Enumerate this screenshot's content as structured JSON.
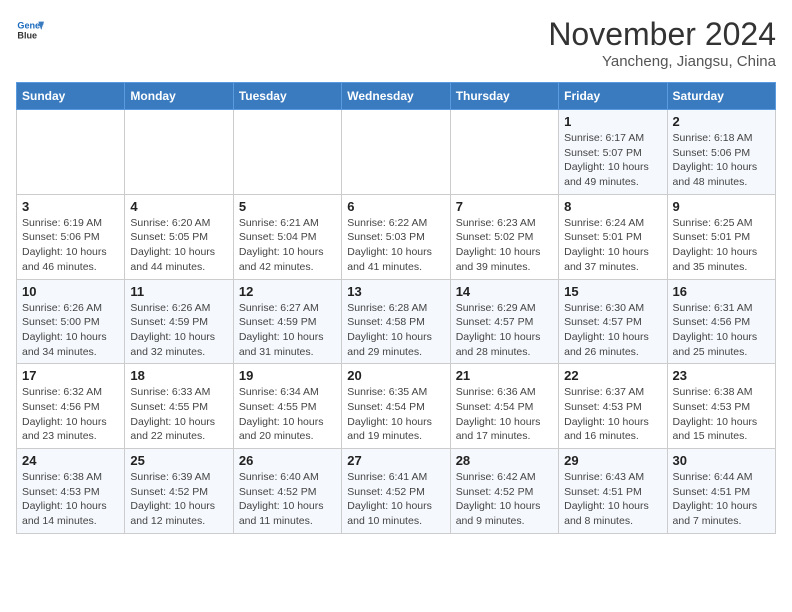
{
  "header": {
    "logo_line1": "General",
    "logo_line2": "Blue",
    "month_title": "November 2024",
    "location": "Yancheng, Jiangsu, China"
  },
  "weekdays": [
    "Sunday",
    "Monday",
    "Tuesday",
    "Wednesday",
    "Thursday",
    "Friday",
    "Saturday"
  ],
  "weeks": [
    [
      {
        "day": "",
        "info": ""
      },
      {
        "day": "",
        "info": ""
      },
      {
        "day": "",
        "info": ""
      },
      {
        "day": "",
        "info": ""
      },
      {
        "day": "",
        "info": ""
      },
      {
        "day": "1",
        "info": "Sunrise: 6:17 AM\nSunset: 5:07 PM\nDaylight: 10 hours and 49 minutes."
      },
      {
        "day": "2",
        "info": "Sunrise: 6:18 AM\nSunset: 5:06 PM\nDaylight: 10 hours and 48 minutes."
      }
    ],
    [
      {
        "day": "3",
        "info": "Sunrise: 6:19 AM\nSunset: 5:06 PM\nDaylight: 10 hours and 46 minutes."
      },
      {
        "day": "4",
        "info": "Sunrise: 6:20 AM\nSunset: 5:05 PM\nDaylight: 10 hours and 44 minutes."
      },
      {
        "day": "5",
        "info": "Sunrise: 6:21 AM\nSunset: 5:04 PM\nDaylight: 10 hours and 42 minutes."
      },
      {
        "day": "6",
        "info": "Sunrise: 6:22 AM\nSunset: 5:03 PM\nDaylight: 10 hours and 41 minutes."
      },
      {
        "day": "7",
        "info": "Sunrise: 6:23 AM\nSunset: 5:02 PM\nDaylight: 10 hours and 39 minutes."
      },
      {
        "day": "8",
        "info": "Sunrise: 6:24 AM\nSunset: 5:01 PM\nDaylight: 10 hours and 37 minutes."
      },
      {
        "day": "9",
        "info": "Sunrise: 6:25 AM\nSunset: 5:01 PM\nDaylight: 10 hours and 35 minutes."
      }
    ],
    [
      {
        "day": "10",
        "info": "Sunrise: 6:26 AM\nSunset: 5:00 PM\nDaylight: 10 hours and 34 minutes."
      },
      {
        "day": "11",
        "info": "Sunrise: 6:26 AM\nSunset: 4:59 PM\nDaylight: 10 hours and 32 minutes."
      },
      {
        "day": "12",
        "info": "Sunrise: 6:27 AM\nSunset: 4:59 PM\nDaylight: 10 hours and 31 minutes."
      },
      {
        "day": "13",
        "info": "Sunrise: 6:28 AM\nSunset: 4:58 PM\nDaylight: 10 hours and 29 minutes."
      },
      {
        "day": "14",
        "info": "Sunrise: 6:29 AM\nSunset: 4:57 PM\nDaylight: 10 hours and 28 minutes."
      },
      {
        "day": "15",
        "info": "Sunrise: 6:30 AM\nSunset: 4:57 PM\nDaylight: 10 hours and 26 minutes."
      },
      {
        "day": "16",
        "info": "Sunrise: 6:31 AM\nSunset: 4:56 PM\nDaylight: 10 hours and 25 minutes."
      }
    ],
    [
      {
        "day": "17",
        "info": "Sunrise: 6:32 AM\nSunset: 4:56 PM\nDaylight: 10 hours and 23 minutes."
      },
      {
        "day": "18",
        "info": "Sunrise: 6:33 AM\nSunset: 4:55 PM\nDaylight: 10 hours and 22 minutes."
      },
      {
        "day": "19",
        "info": "Sunrise: 6:34 AM\nSunset: 4:55 PM\nDaylight: 10 hours and 20 minutes."
      },
      {
        "day": "20",
        "info": "Sunrise: 6:35 AM\nSunset: 4:54 PM\nDaylight: 10 hours and 19 minutes."
      },
      {
        "day": "21",
        "info": "Sunrise: 6:36 AM\nSunset: 4:54 PM\nDaylight: 10 hours and 17 minutes."
      },
      {
        "day": "22",
        "info": "Sunrise: 6:37 AM\nSunset: 4:53 PM\nDaylight: 10 hours and 16 minutes."
      },
      {
        "day": "23",
        "info": "Sunrise: 6:38 AM\nSunset: 4:53 PM\nDaylight: 10 hours and 15 minutes."
      }
    ],
    [
      {
        "day": "24",
        "info": "Sunrise: 6:38 AM\nSunset: 4:53 PM\nDaylight: 10 hours and 14 minutes."
      },
      {
        "day": "25",
        "info": "Sunrise: 6:39 AM\nSunset: 4:52 PM\nDaylight: 10 hours and 12 minutes."
      },
      {
        "day": "26",
        "info": "Sunrise: 6:40 AM\nSunset: 4:52 PM\nDaylight: 10 hours and 11 minutes."
      },
      {
        "day": "27",
        "info": "Sunrise: 6:41 AM\nSunset: 4:52 PM\nDaylight: 10 hours and 10 minutes."
      },
      {
        "day": "28",
        "info": "Sunrise: 6:42 AM\nSunset: 4:52 PM\nDaylight: 10 hours and 9 minutes."
      },
      {
        "day": "29",
        "info": "Sunrise: 6:43 AM\nSunset: 4:51 PM\nDaylight: 10 hours and 8 minutes."
      },
      {
        "day": "30",
        "info": "Sunrise: 6:44 AM\nSunset: 4:51 PM\nDaylight: 10 hours and 7 minutes."
      }
    ]
  ]
}
